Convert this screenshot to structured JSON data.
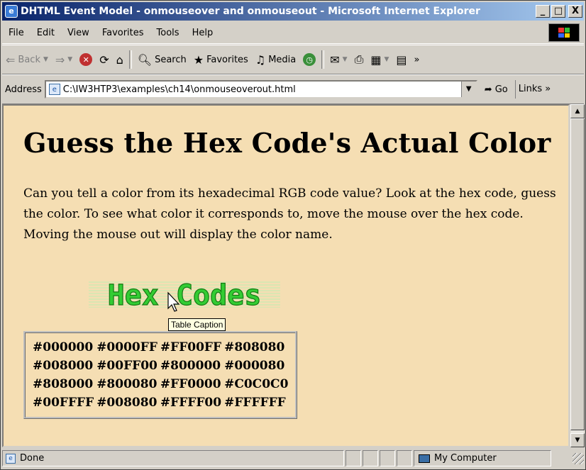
{
  "window": {
    "title": "DHTML Event Model - onmouseover and onmouseout - Microsoft Internet Explorer",
    "btn_minimize": "_",
    "btn_maximize": "□",
    "btn_close": "X"
  },
  "menu": [
    "File",
    "Edit",
    "View",
    "Favorites",
    "Tools",
    "Help"
  ],
  "toolbar": {
    "back": "Back",
    "search": "Search",
    "favorites": "Favorites",
    "media": "Media"
  },
  "address": {
    "label": "Address",
    "url": "C:\\IW3HTP3\\examples\\ch14\\onmouseoverout.html",
    "go": "Go",
    "links": "Links"
  },
  "page": {
    "heading": "Guess the Hex Code's Actual Color",
    "paragraph": "Can you tell a color from its hexadecimal RGB code value? Look at the hex code, guess the color. To see what color it corresponds to, move the mouse over the hex code. Moving the mouse out will display the color name.",
    "caption_image_text": "Hex Codes",
    "tooltip": "Table Caption",
    "hex_rows": [
      [
        "#000000",
        "#0000FF",
        "#FF00FF",
        "#808080"
      ],
      [
        "#008000",
        "#00FF00",
        "#800000",
        "#000080"
      ],
      [
        "#808000",
        "#800080",
        "#FF0000",
        "#C0C0C0"
      ],
      [
        "#00FFFF",
        "#008080",
        "#FFFF00",
        "#FFFFFF"
      ]
    ]
  },
  "status": {
    "text": "Done",
    "zone": "My Computer"
  },
  "colors": {
    "page_background": "#f5deb3",
    "caption_green": "#33cc33"
  }
}
